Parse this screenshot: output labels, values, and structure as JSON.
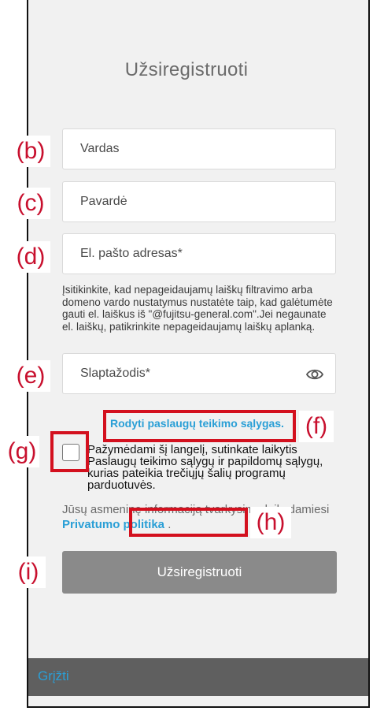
{
  "title": "Užsiregistruoti",
  "fields": {
    "first_name_placeholder": "Vardas",
    "last_name_placeholder": "Pavardė",
    "email_placeholder": "El. pašto adresas*",
    "password_placeholder": "Slaptažodis*"
  },
  "email_helper": "Įsitikinkite, kad nepageidaujamų laiškų filtravimo arba domeno vardo nustatymus nustatėte taip, kad galėtumėte gauti el. laiškus iš \"@fujitsu-general.com\".Jei negaunate el. laiškų, patikrinkite nepageidaujamų laiškų aplanką.",
  "terms_link": "Rodyti paslaugų teikimo sąlygas.",
  "consent_text": "Pažymėdami šį langelį, sutinkate laikytis Paslaugų teikimo sąlygų ir papildomų sąlygų, kurias pateikia trečiųjų šalių programų parduotuvės.",
  "privacy": {
    "text": "Jūsų asmeninę informaciją tvarkysime laikydamiesi",
    "link": "Privatumo politika",
    "suffix": "."
  },
  "submit_label": "Užsiregistruoti",
  "back_label": "Grįžti",
  "annotations": {
    "b": "(b)",
    "c": "(c)",
    "d": "(d)",
    "e": "(e)",
    "f": "(f)",
    "g": "(g)",
    "h": "(h)",
    "i": "(i)"
  },
  "icons": {
    "password_toggle": "eye-icon"
  },
  "colors": {
    "link": "#2a9fd6",
    "button": "#8a8a8a",
    "footer": "#5f5f5f",
    "annotation": "#c8102e"
  }
}
